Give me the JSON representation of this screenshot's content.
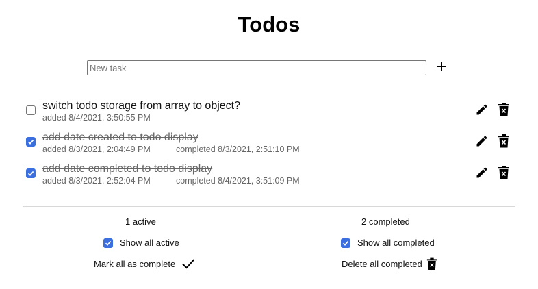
{
  "page": {
    "title": "Todos"
  },
  "new_task": {
    "placeholder": "New task",
    "value": "",
    "add_icon": "plus-icon"
  },
  "todos": [
    {
      "text": "switch todo storage from array to object?",
      "completed": false,
      "added": "added 8/4/2021, 3:50:55 PM",
      "completed_at": ""
    },
    {
      "text": "add date created to todo display",
      "completed": true,
      "added": "added 8/3/2021, 2:04:49 PM",
      "completed_at": "completed 8/3/2021, 2:51:10 PM"
    },
    {
      "text": "add date completed to todo display",
      "completed": true,
      "added": "added 8/3/2021, 2:52:04 PM",
      "completed_at": "completed 8/4/2021, 3:51:09 PM"
    }
  ],
  "footer": {
    "active": {
      "count_label": "1 active",
      "filter_label": "Show all active",
      "filter_checked": true,
      "action_label": "Mark all as complete",
      "action_icon": "checkmark-icon"
    },
    "completed": {
      "count_label": "2 completed",
      "filter_label": "Show all completed",
      "filter_checked": true,
      "action_label": "Delete all completed",
      "action_icon": "trash-x-icon"
    }
  },
  "colors": {
    "checkbox_accent": "#3b6fe0",
    "muted_text": "#666666",
    "divider": "#d8d8d8"
  }
}
